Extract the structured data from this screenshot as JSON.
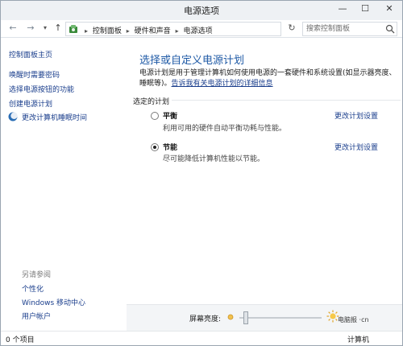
{
  "window": {
    "title": "电源选项",
    "minimize": "—",
    "maximize": "☐",
    "close": "✕"
  },
  "address": {
    "breadcrumbs": [
      "控制面板",
      "硬件和声音",
      "电源选项"
    ],
    "search_placeholder": "搜索控制面板"
  },
  "left_pane": {
    "home": "控制面板主页",
    "links": [
      "唤醒时需要密码",
      "选择电源按钮的功能",
      "创建电源计划",
      "更改计算机睡眠时间"
    ],
    "see_also_title": "另请参阅",
    "see_also": [
      "个性化",
      "Windows 移动中心",
      "用户帐户"
    ]
  },
  "main": {
    "heading": "选择或自定义电源计划",
    "description": "电源计划是用于管理计算机如何使用电源的一套硬件和系统设置(如显示器亮度、睡眠等)。",
    "description_link": "告诉我有关电源计划的详细信息",
    "section_title": "选定的计划",
    "plans": [
      {
        "name": "平衡",
        "description": "利用可用的硬件自动平衡功耗与性能。",
        "change_link": "更改计划设置",
        "selected": false
      },
      {
        "name": "节能",
        "description": "尽可能降低计算机性能以节能。",
        "change_link": "更改计划设置",
        "selected": true
      }
    ]
  },
  "brightness": {
    "label": "屏幕亮度:",
    "level": 0.05,
    "watermark": "电脑报 ·cn"
  },
  "status": {
    "items_count": "0 个项目",
    "right_text": "计算机"
  },
  "colors": {
    "link": "#1a3e8c",
    "heading": "#1f5aa6",
    "help_icon": "#2b66c5"
  },
  "icons": {
    "help": "?",
    "nav_up": "↑"
  }
}
